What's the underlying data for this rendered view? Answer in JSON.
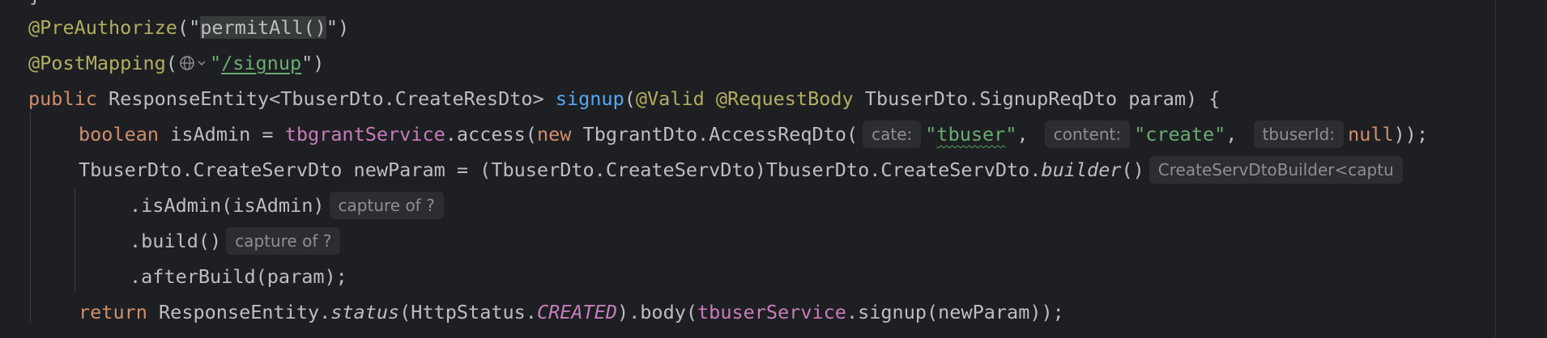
{
  "editor": {
    "lines": [
      {
        "tokens": [
          "@PreAuthorize",
          "(\"",
          "permitAll()",
          "\")"
        ]
      },
      {
        "tokens": [
          "@PostMapping",
          "(",
          "\"",
          "/signup",
          "\")"
        ]
      },
      {
        "tokens": [
          "public",
          " ResponseEntity<TbuserDto.CreateResDto> ",
          "signup",
          "(",
          "@Valid",
          " ",
          "@RequestBody",
          " TbuserDto.SignupReqDto param) {"
        ]
      },
      {
        "tokens": [
          "boolean",
          " isAdmin = ",
          "tbgrantService",
          ".access(",
          "new",
          " TbgrantDto.AccessReqDto(",
          "\"",
          "tbuser",
          "\"",
          ", ",
          "\"create\"",
          ", ",
          "null",
          "));"
        ]
      },
      {
        "tokens": [
          "TbuserDto.CreateServDto newParam = (TbuserDto.CreateServDto)TbuserDto.CreateServDto.",
          "builder",
          "()"
        ]
      },
      {
        "tokens": [
          ".isAdmin(isAdmin)"
        ]
      },
      {
        "tokens": [
          ".build()"
        ]
      },
      {
        "tokens": [
          ".afterBuild(param);"
        ]
      },
      {
        "tokens": [
          "return",
          " ResponseEntity.",
          "status",
          "(HttpStatus.",
          "CREATED",
          ").body(",
          "tbuserService",
          ".signup(newParam));"
        ]
      }
    ],
    "hints": {
      "cate": "cate:",
      "content": "content:",
      "tbuserId": "tbuserId:",
      "builder_type": "CreateServDtoBuilder<captu",
      "capture1": "capture of ?",
      "capture2": "capture of ?"
    },
    "icons": {
      "globe": "globe-icon",
      "chevron": "chevron-down-icon"
    },
    "colors": {
      "background": "#1e1f22",
      "keyword": "#cf8e6d",
      "annotation": "#b3ae60",
      "string": "#6aab73",
      "field": "#c77dbb",
      "method": "#56a8f5",
      "text": "#bcbec4",
      "hint_bg": "#2b2d30",
      "hint_text": "#8c8f94"
    }
  }
}
